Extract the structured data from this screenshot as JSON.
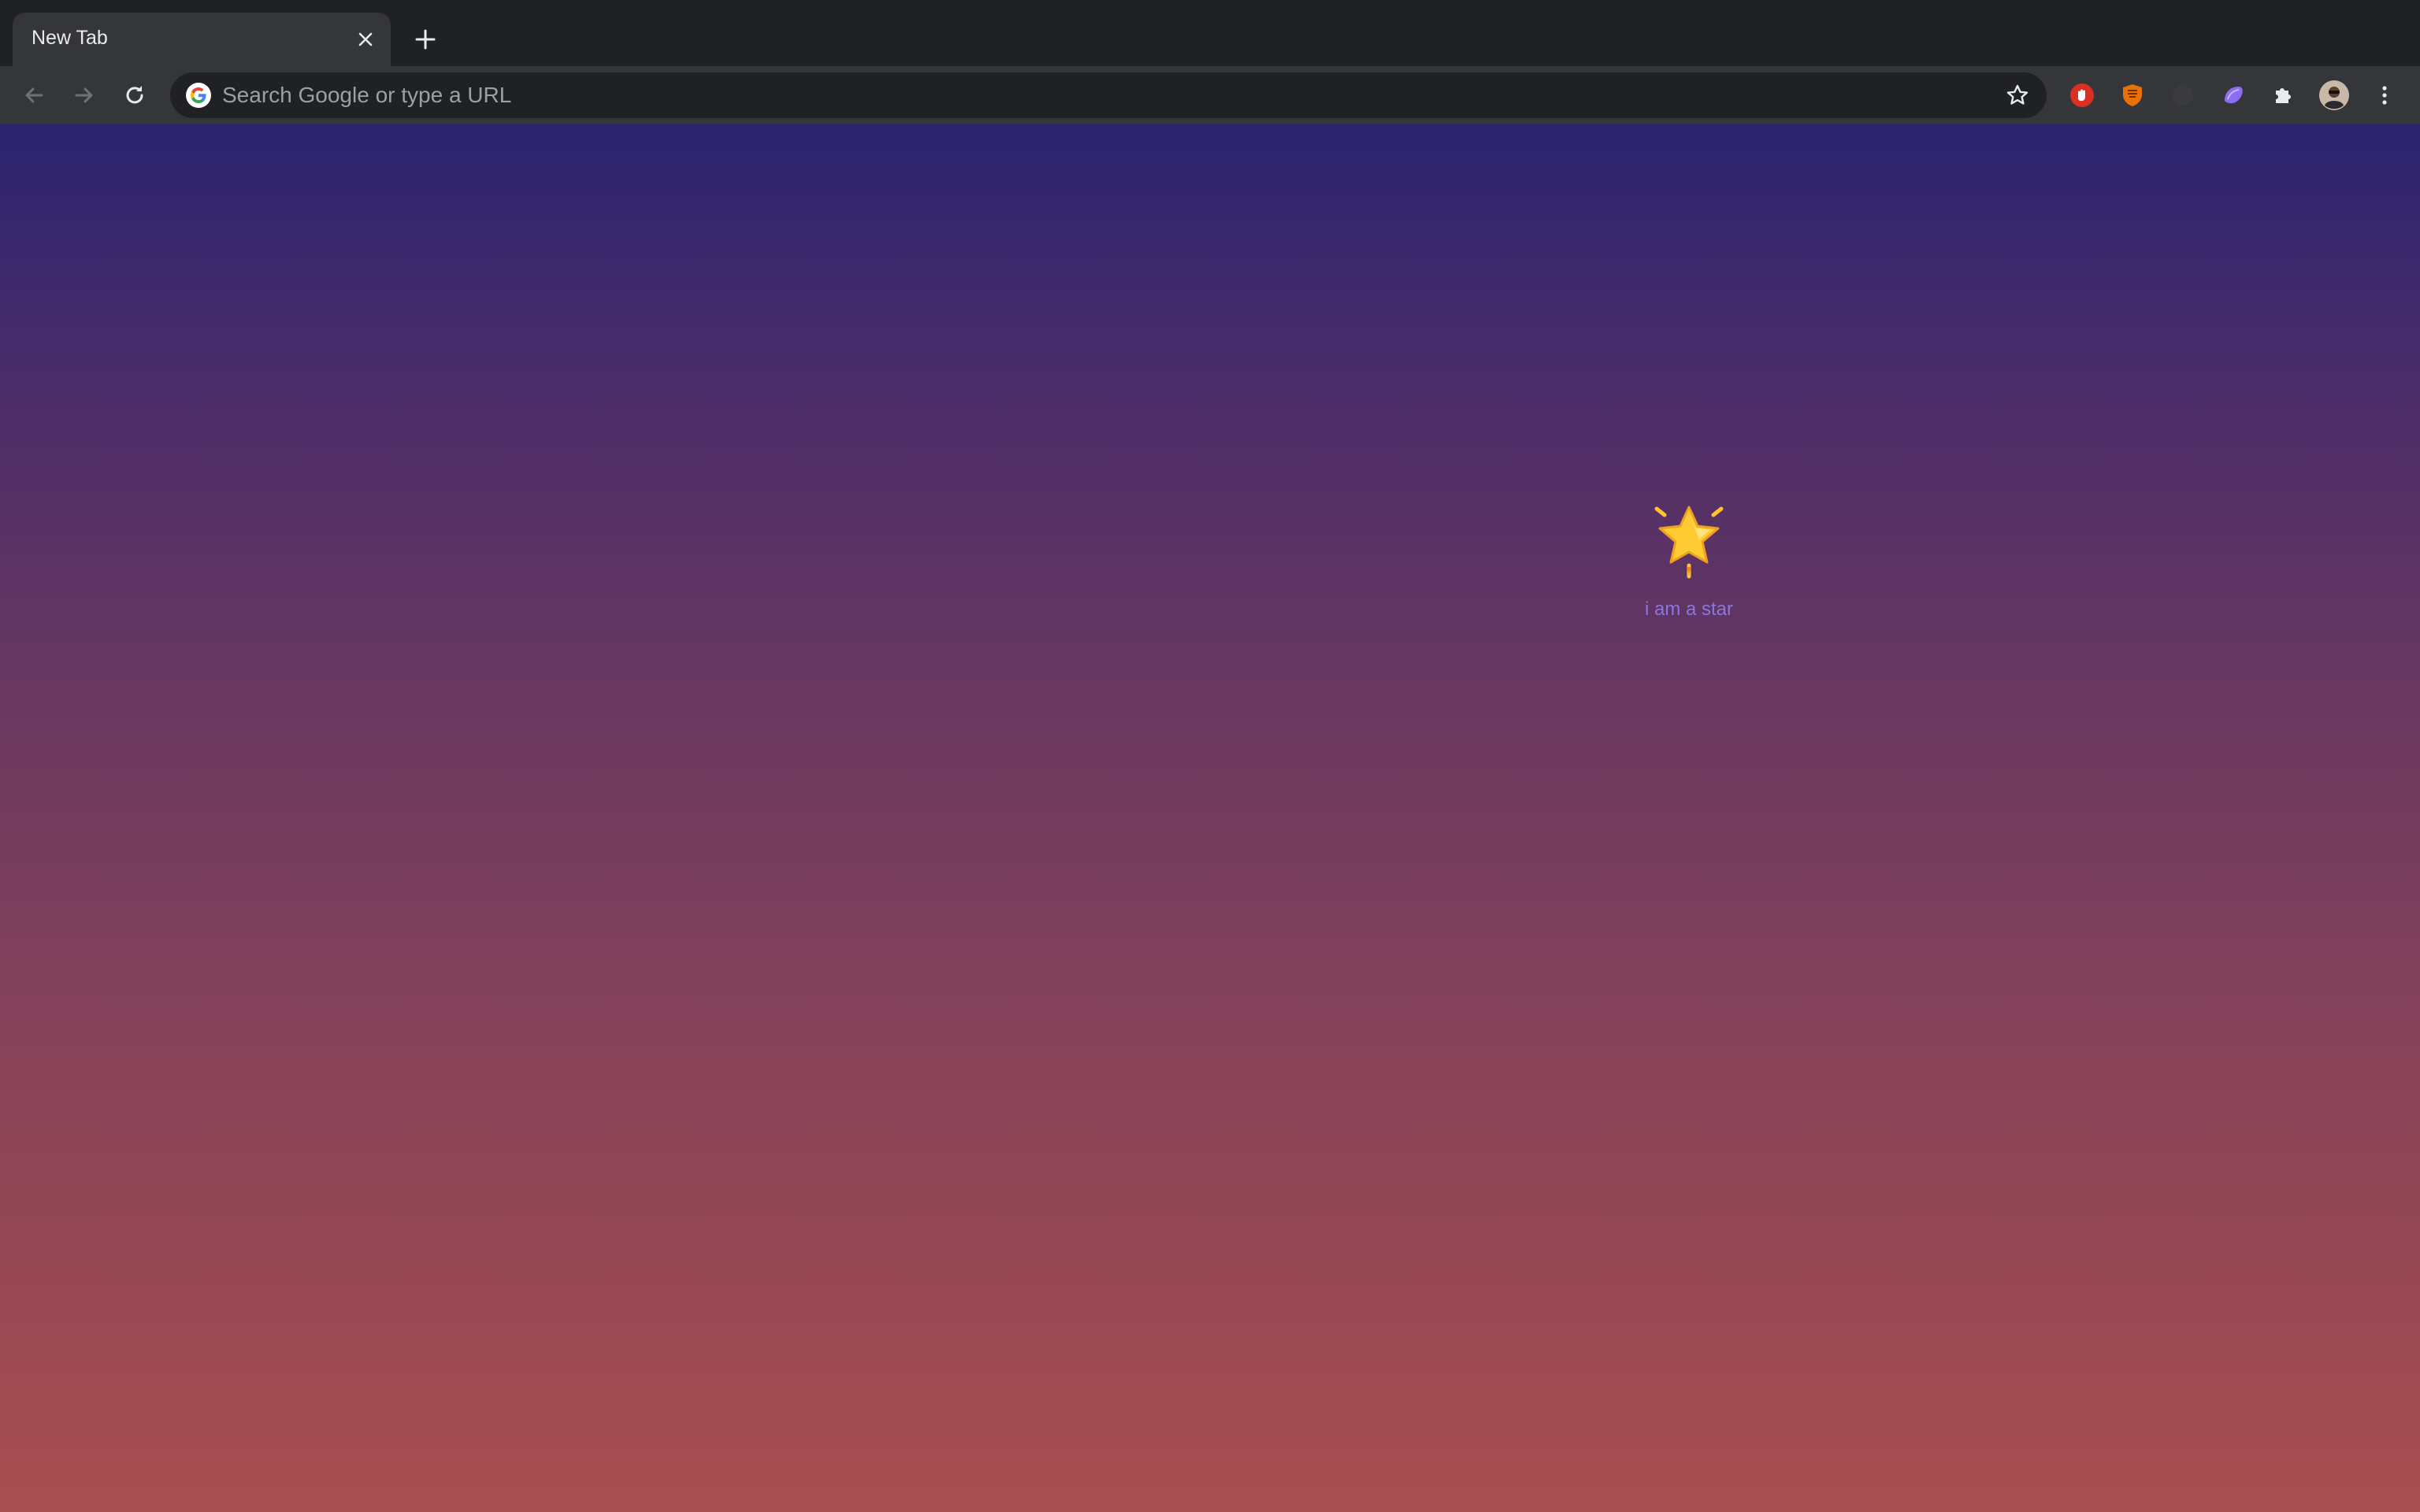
{
  "tab": {
    "title": "New Tab"
  },
  "omnibox": {
    "placeholder": "Search Google or type a URL",
    "value": ""
  },
  "icons": {
    "back": "back-arrow-icon",
    "forward": "forward-arrow-icon",
    "reload": "reload-icon",
    "new_tab": "plus-icon",
    "close_tab": "close-icon",
    "google": "google-logo-icon",
    "bookmark": "star-outline-icon",
    "extensions": [
      "red-hand-extension-icon",
      "orange-shield-extension-icon",
      "dark-extension-icon",
      "purple-extension-icon",
      "puzzle-icon"
    ],
    "profile": "avatar",
    "menu": "kebab-menu-icon"
  },
  "content": {
    "emoji": "glowing-star",
    "caption": "i am a star"
  },
  "colors": {
    "frame": "#202124",
    "toolbar": "#35363a",
    "gradient_top": "#2c2470",
    "gradient_bottom": "#a74e50",
    "caption": "#8877e0"
  }
}
